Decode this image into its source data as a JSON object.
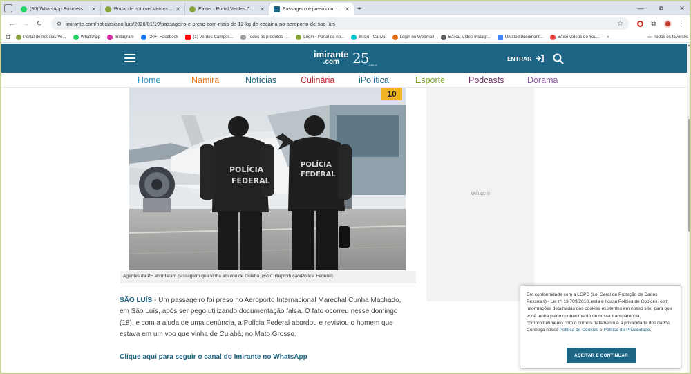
{
  "browser": {
    "tabs": [
      {
        "title": "(80) WhatsApp Business",
        "favicon_color": "#25d366",
        "active": false
      },
      {
        "title": "Portal de notícias Verdes Campos",
        "favicon_color": "#8aa33a",
        "active": false
      },
      {
        "title": "Painel ‹ Portal Verdes Campos",
        "favicon_color": "#8aa33a",
        "active": false
      },
      {
        "title": "Passageiro é preso com cocaína",
        "favicon_color": "#1d6585",
        "active": true
      }
    ],
    "new_tab": "+",
    "window_controls": {
      "minimize": "—",
      "maximize": "⧉",
      "close": "✕"
    },
    "url": "imirante.com/noticias/sao-luis/2026/01/19/passageiro-e-preso-com-mais-de-12-kg-de-cocaina-no-aeroporto-de-sao-luis",
    "bookmarks": [
      {
        "label": "Portal de notícias Ve...",
        "color": "#8aa33a"
      },
      {
        "label": "WhatsApp",
        "color": "#25d366"
      },
      {
        "label": "Instagram",
        "color": "#d6249f"
      },
      {
        "label": "(20+) Facebook",
        "color": "#1877f2"
      },
      {
        "label": "(1) Verdes Campos...",
        "color": "#ff0000"
      },
      {
        "label": "Todos os produtos -...",
        "color": "#999999"
      },
      {
        "label": "Login ‹ Portal de no...",
        "color": "#8aa33a"
      },
      {
        "label": "Início - Canva",
        "color": "#00c4cc"
      },
      {
        "label": "Login no Webmail",
        "color": "#e8711c"
      },
      {
        "label": "Baixar Vídeo Instagr...",
        "color": "#555555"
      },
      {
        "label": "Untitled document...",
        "color": "#4285f4"
      },
      {
        "label": "Baixe vídeos do You...",
        "color": "#e8453c"
      }
    ],
    "bookmarks_overflow": "»",
    "all_bookmarks": "Todos os favoritos"
  },
  "site": {
    "logo_text": "imirante",
    "logo_sub": ".com",
    "logo_anniversary": "25",
    "logo_anniversary_sub": "ANOS",
    "login_label": "ENTRAR",
    "nav": [
      {
        "label": "Home",
        "color": "#2a8fbf"
      },
      {
        "label": "Namira",
        "color": "#e07a1f"
      },
      {
        "label": "Notícias",
        "color": "#1d6585"
      },
      {
        "label": "Culinária",
        "color": "#c0282f"
      },
      {
        "label": "iPolítica",
        "color": "#1d6585"
      },
      {
        "label": "Esporte",
        "color": "#7ba12c"
      },
      {
        "label": "Podcasts",
        "color": "#6b2c5f"
      },
      {
        "label": "Dorama",
        "color": "#8e5aa6"
      }
    ],
    "brand_color": "#1d6585"
  },
  "article": {
    "image_caption": "Agentes da PF abordaram passageiro que vinha em voo de Cuiabá. (Foto: Reprodução/Polícia Federal)",
    "image_text": {
      "vest_left": "POLÍCIA FEDERAL",
      "vest_right": "POLÍCIA FEDERAL",
      "gate_number": "10"
    },
    "location": "SÃO LUÍS",
    "lead": " - Um passageiro foi preso no Aeroporto Internacional Marechal Cunha Machado, em São Luís, após ser pego utilizando documentação falsa. O fato ocorreu nesse domingo (18), e com a ajuda de uma denúncia, a Polícia Federal abordou e revistou o homem que estava em um voo que vinha de Cuiabá, no Mato Grosso.",
    "whatsapp_link": "Clique aqui para seguir o canal do Imirante no WhatsApp"
  },
  "ad": {
    "label": "ANÚNCIO"
  },
  "cookie_banner": {
    "text_before": "Em conformidade com a LGPD (Lei Geral de Proteção de Dados Pessoais) - Lei nº 13.709/2018, esta é nossa Política de Cookies, com informações detalhadas dos cookies existentes em nosso site, para que você tenha pleno conhecimento de nossa transparência, comprometimento com o correto tratamento e a privacidade dos dados. Conheça nossa ",
    "link1": "Política de Cookies",
    "text_mid": " e ",
    "link2": "Política de Privacidade",
    "text_end": ".",
    "button": "ACEITAR E CONTINUAR"
  }
}
